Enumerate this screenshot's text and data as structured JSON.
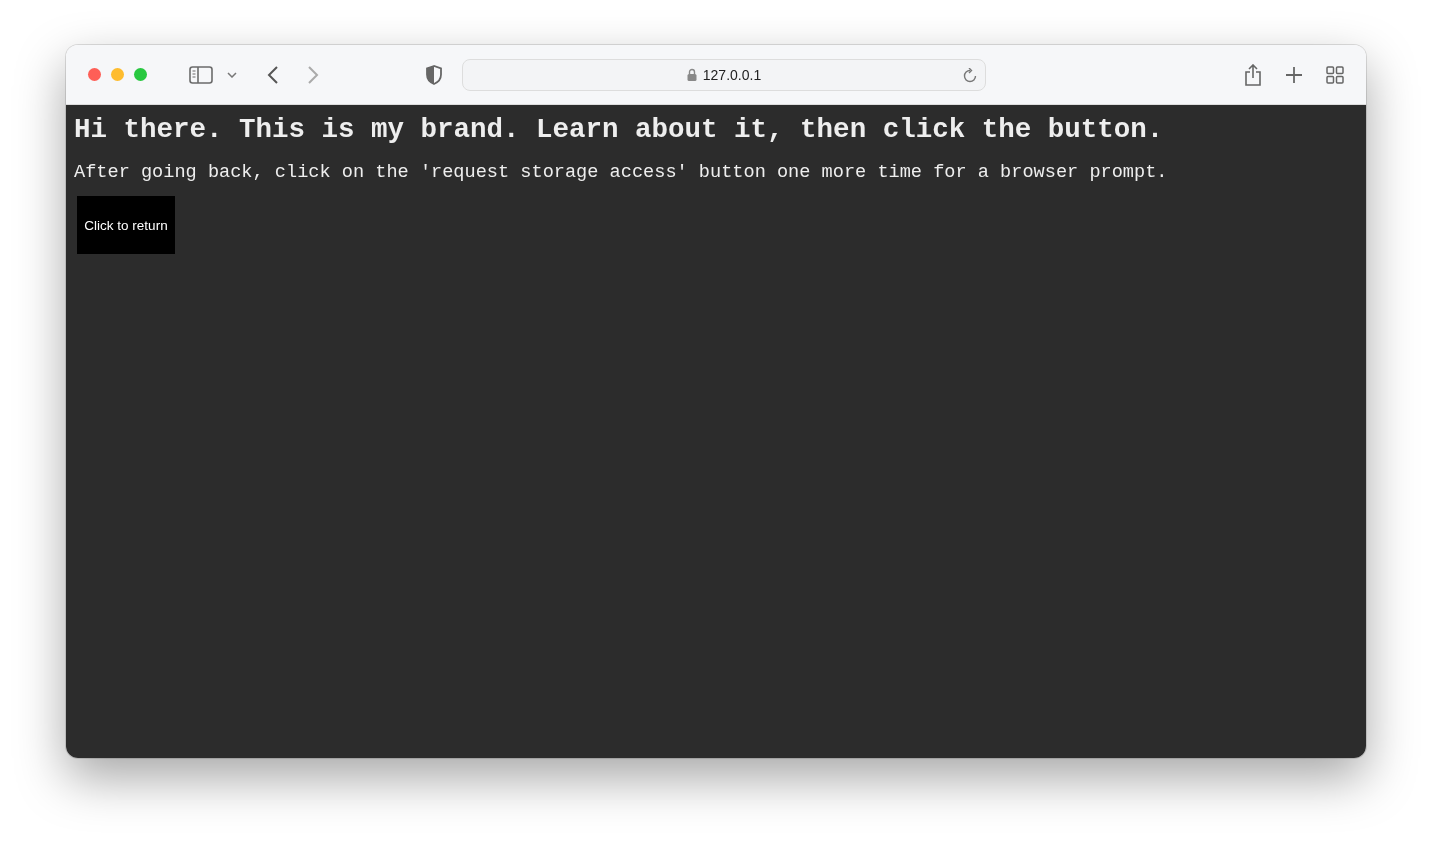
{
  "browser": {
    "address": "127.0.0.1"
  },
  "page": {
    "heading": "Hi there. This is my brand. Learn about it, then click the button.",
    "text": "After going back, click on the 'request storage access' button one more time for a browser prompt.",
    "button": "Click to return"
  }
}
